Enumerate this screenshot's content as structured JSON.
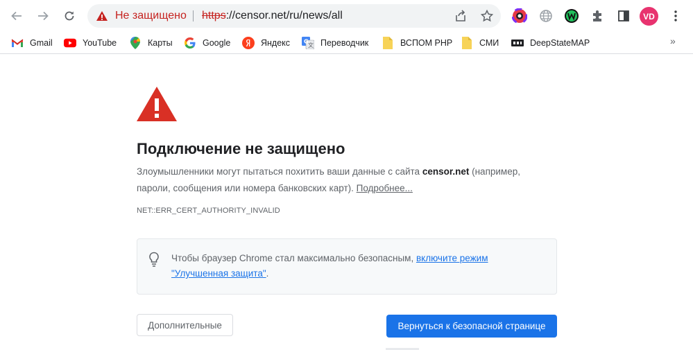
{
  "toolbar": {
    "omnibox_status": "Не защищено",
    "url_scheme": "https",
    "url_rest": "://censor.net/ru/news/all",
    "avatar_initials": "VD"
  },
  "bookmarks": [
    {
      "label": "Gmail",
      "icon": "gmail-icon"
    },
    {
      "label": "YouTube",
      "icon": "youtube-icon"
    },
    {
      "label": "Карты",
      "icon": "maps-icon"
    },
    {
      "label": "Google",
      "icon": "google-icon"
    },
    {
      "label": "Яндекс",
      "icon": "yandex-icon"
    },
    {
      "label": "Переводчик",
      "icon": "translate-icon"
    },
    {
      "label": "ВСПОМ PHP",
      "icon": "folder-icon"
    },
    {
      "label": "СМИ",
      "icon": "folder-icon"
    },
    {
      "label": "DeepStateMAP",
      "icon": "deepstate-icon"
    }
  ],
  "bookmarks_more": "»",
  "interstitial": {
    "heading": "Подключение не защищено",
    "body_prefix": "Злоумышленники могут пытаться похитить ваши данные с сайта ",
    "body_domain": "censor.net",
    "body_suffix": " (например, пароли, сообщения или номера банковских карт). ",
    "body_link": "Подробнее...",
    "error_code": "NET::ERR_CERT_AUTHORITY_INVALID",
    "tip_prefix": "Чтобы браузер Chrome стал максимально безопасным, ",
    "tip_link": "включите режим \"Улучшенная защита\"",
    "tip_suffix": ".",
    "advanced_button": "Дополнительные",
    "back_button": "Вернуться к безопасной странице"
  },
  "colors": {
    "danger": "#d93025",
    "primary_button": "#1a73e8",
    "avatar": "#e8336f"
  }
}
